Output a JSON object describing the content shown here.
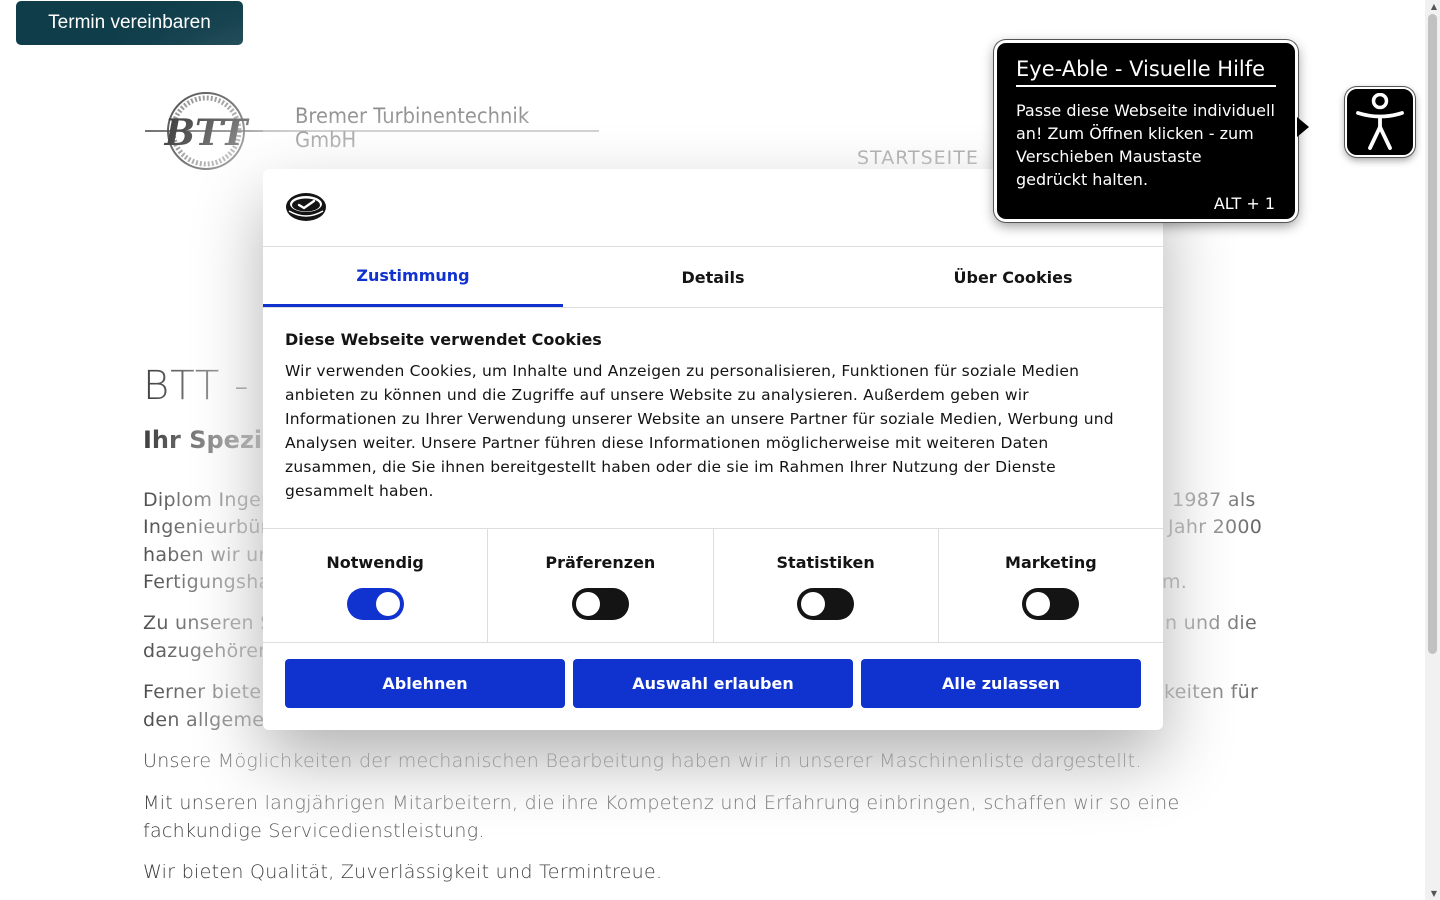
{
  "header": {
    "cta_label": "Termin vereinbaren",
    "company_name": "Bremer Turbinentechnik GmbH",
    "logo_text": "BTT",
    "nav_start": "STARTSEITE"
  },
  "hero": {
    "title": "BTT -",
    "subtitle": "Ihr Spezi"
  },
  "content": {
    "p1_left_1": "Diplom Inger",
    "p1_right_1": "1987 als",
    "p1_left_2": "Ingenieurbür",
    "p1_right_2": "Jahr 2000",
    "p1_left_3": "haben wir ur",
    "p1_left_4": "Fertigungsha",
    "p1_right_4": "m.",
    "p2_left_1": "Zu unseren S",
    "p2_right_1": "n und die",
    "p2_left_2": "dazugehörer",
    "p3_left_1": "Ferner biete",
    "p3_right_1": "keiten für",
    "p3_left_2": "den allgeme",
    "p4": "Unsere Möglichkeiten der mechanischen Bearbeitung haben wir in unserer Maschinenliste dargestellt.",
    "p5": "Mit unseren langjährigen Mitarbeitern, die ihre Kompetenz und Erfahrung einbringen, schaffen wir so eine fachkundige Servicedienstleistung.",
    "p6": "Wir bieten Qualität, Zuverlässigkeit und Termintreue."
  },
  "cookie": {
    "tabs": [
      "Zustimmung",
      "Details",
      "Über Cookies"
    ],
    "heading": "Diese Webseite verwendet Cookies",
    "text": "Wir verwenden Cookies, um Inhalte und Anzeigen zu personalisieren, Funktionen für soziale Medien anbieten zu können und die Zugriffe auf unsere Website zu analysieren. Außerdem geben wir Informationen zu Ihrer Verwendung unserer Website an unsere Partner für soziale Medien, Werbung und Analysen weiter. Unsere Partner führen diese Informationen möglicherweise mit weiteren Daten zusammen, die Sie ihnen bereitgestellt haben oder die sie im Rahmen Ihrer Nutzung der Dienste gesammelt haben.",
    "toggles": [
      {
        "label": "Notwendig",
        "on": true
      },
      {
        "label": "Präferenzen",
        "on": false
      },
      {
        "label": "Statistiken",
        "on": false
      },
      {
        "label": "Marketing",
        "on": false
      }
    ],
    "buttons": {
      "reject": "Ablehnen",
      "allow_selection": "Auswahl erlauben",
      "allow_all": "Alle zulassen"
    },
    "accent_color": "#1032cf"
  },
  "eye_able": {
    "title": "Eye-Able - Visuelle Hilfe",
    "text": "Passe diese Webseite individuell an! Zum Öffnen klicken - zum Verschieben Maustaste gedrückt halten.",
    "shortcut": "ALT + 1",
    "icon": "accessibility-person-icon"
  },
  "colors": {
    "cta_bg": "#0f3d4a"
  }
}
